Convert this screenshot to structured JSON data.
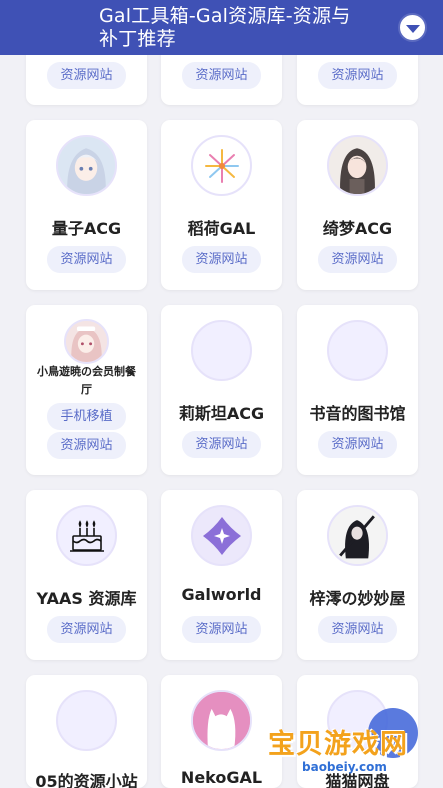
{
  "header": {
    "title": "Gal工具箱-Gal资源库-资源与补丁推荐",
    "menu_icon": "chevron-down-icon"
  },
  "tag_resource": "资源网站",
  "cards": [
    {
      "name": "",
      "tags": [
        "资源网站"
      ]
    },
    {
      "name": "",
      "tags": [
        "资源网站"
      ]
    },
    {
      "name": "",
      "tags": [
        "资源网站"
      ]
    },
    {
      "name": "量子ACG",
      "tags": [
        "资源网站"
      ],
      "icon": "anime-girl-avatar"
    },
    {
      "name": "稻荷GAL",
      "tags": [
        "资源网站"
      ],
      "icon": "firework-logo"
    },
    {
      "name": "绮梦ACG",
      "tags": [
        "资源网站"
      ],
      "icon": "dark-hair-girl-avatar"
    },
    {
      "name": "小鳥遊暁の会员制餐厅",
      "tags": [
        "手机移植",
        "资源网站"
      ],
      "icon": "pink-hair-girl-avatar"
    },
    {
      "name": "莉斯坦ACG",
      "tags": [
        "资源网站"
      ],
      "icon": "blank-avatar"
    },
    {
      "name": "书音的图书馆",
      "tags": [
        "资源网站"
      ],
      "icon": "blank-avatar"
    },
    {
      "name": "YAAS 资源库",
      "tags": [
        "资源网站"
      ],
      "icon": "cake-icon"
    },
    {
      "name": "Galworld",
      "tags": [
        "资源网站"
      ],
      "icon": "star-clover-logo"
    },
    {
      "name": "梓澪の妙妙屋",
      "tags": [
        "资源网站"
      ],
      "icon": "sword-girl-avatar"
    },
    {
      "name": "05的资源小站",
      "tags": [],
      "icon": "blank-avatar"
    },
    {
      "name": "NekoGAL",
      "tags": [],
      "icon": "cat-silhouette-logo"
    },
    {
      "name": "猫猫网盘",
      "tags": [],
      "icon": "blank-avatar"
    }
  ],
  "watermark": {
    "text": "宝贝游戏网",
    "url": "baobeiy.com"
  }
}
